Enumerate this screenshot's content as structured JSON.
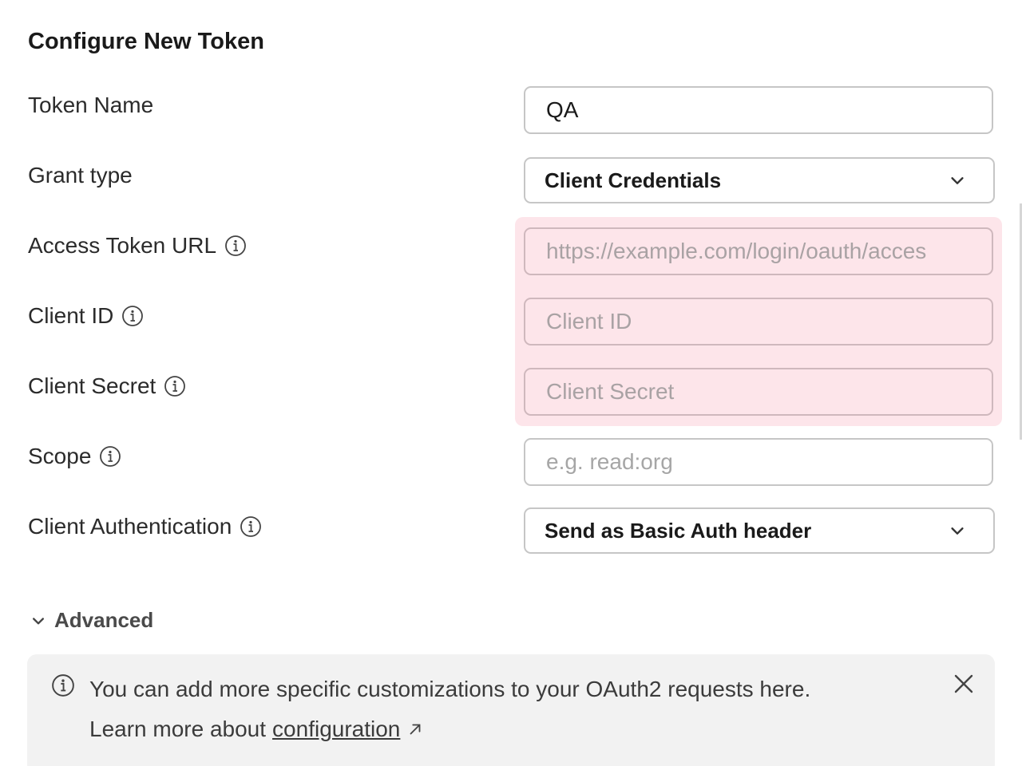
{
  "title": "Configure New Token",
  "fields": {
    "token_name": {
      "label": "Token Name",
      "value": "QA"
    },
    "grant_type": {
      "label": "Grant type",
      "selected": "Client Credentials"
    },
    "access_token_url": {
      "label": "Access Token URL",
      "placeholder": "https://example.com/login/oauth/acces"
    },
    "client_id": {
      "label": "Client ID",
      "placeholder": "Client ID"
    },
    "client_secret": {
      "label": "Client Secret",
      "placeholder": "Client Secret"
    },
    "scope": {
      "label": "Scope",
      "placeholder": "e.g. read:org"
    },
    "client_authentication": {
      "label": "Client Authentication",
      "selected": "Send as Basic Auth header"
    }
  },
  "advanced": {
    "label": "Advanced"
  },
  "notice": {
    "line1": "You can add more specific customizations to your OAuth2 requests here.",
    "line2_prefix": "Learn more about",
    "link": "configuration"
  },
  "colors": {
    "error_bg": "#fde5ea",
    "notice_bg": "#f2f2f2",
    "border": "#c6c6c6"
  }
}
